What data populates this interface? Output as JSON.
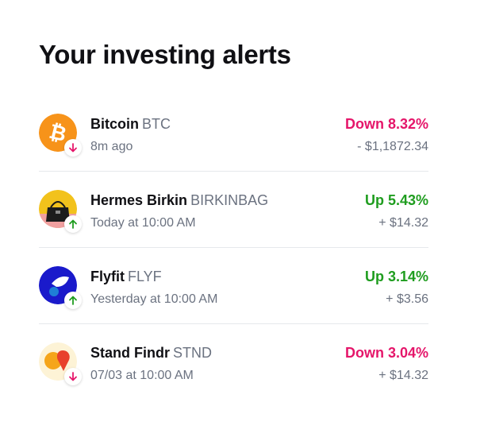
{
  "header": {
    "title": "Your investing alerts"
  },
  "colors": {
    "down": "#e5166a",
    "up": "#1f9d1f",
    "muted": "#6b7280"
  },
  "alerts": [
    {
      "name": "Bitcoin",
      "ticker": "BTC",
      "time": "8m ago",
      "change": "Down 8.32%",
      "amount": "- $1,1872.34",
      "direction": "down",
      "icon": "bitcoin-logo-icon"
    },
    {
      "name": "Hermes Birkin",
      "ticker": "BIRKINBAG",
      "time": "Today at 10:00 AM",
      "change": "Up 5.43%",
      "amount": "+ $14.32",
      "direction": "up",
      "icon": "handbag-icon"
    },
    {
      "name": "Flyfit",
      "ticker": "FLYF",
      "time": "Yesterday at 10:00 AM",
      "change": "Up 3.14%",
      "amount": "+ $3.56",
      "direction": "up",
      "icon": "flyfit-logo-icon"
    },
    {
      "name": "Stand Findr",
      "ticker": "STND",
      "time": "07/03 at 10:00 AM",
      "change": "Down 3.04%",
      "amount": "+ $14.32",
      "direction": "down",
      "icon": "stand-findr-logo-icon"
    }
  ]
}
